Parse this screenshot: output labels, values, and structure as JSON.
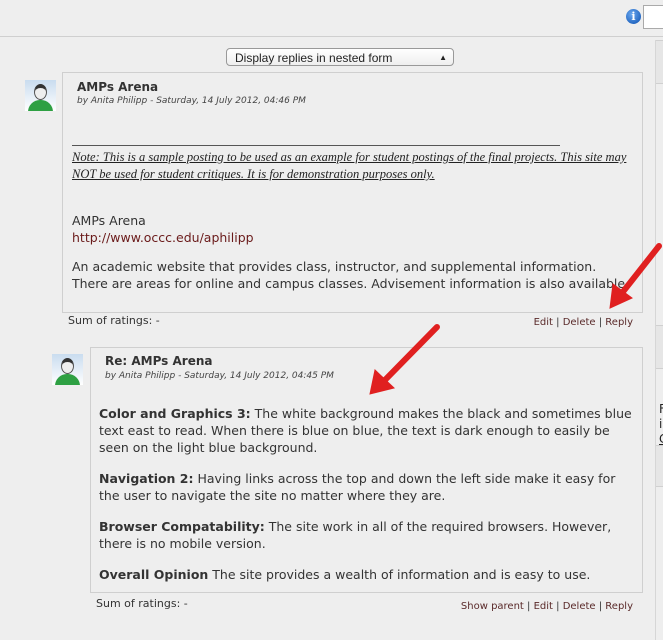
{
  "display_select": {
    "value": "Display replies in nested form"
  },
  "posts": [
    {
      "title": "AMPs Arena",
      "byline": "by Anita Philipp - Saturday, 14 July 2012, 04:46 PM",
      "note": "Note: This is a sample posting to be used as an example for student postings of the final projects. This site may NOT be used for student critiques. It is for demonstration purposes only.",
      "site_name": "AMPs Arena",
      "site_url": "http://www.occc.edu/aphilipp",
      "body": "An academic website that provides class, instructor, and supplemental information.  There are areas for online and campus classes. Advisement information is also available.",
      "ratings": "Sum of ratings: -",
      "commands": [
        "Edit",
        "Delete",
        "Reply"
      ]
    },
    {
      "title": "Re: AMPs Arena",
      "byline": "by Anita Philipp - Saturday, 14 July 2012, 04:45 PM",
      "paragraphs": [
        {
          "label": "Color and Graphics 3:",
          "text": " The white background makes the black and sometimes blue text east to read.  When there is blue on blue, the text is dark enough to easily be seen on the light blue background."
        },
        {
          "label": "Navigation 2:",
          "text": " Having links across the top and down the left side make it easy for the user to navigate the site no matter where they are."
        },
        {
          "label": "Browser Compatability:",
          "text": " The site work in all of the required browsers.  However, there is no mobile version."
        },
        {
          "label": "Overall Opinion",
          "text": " The site provides a wealth of information and is easy to use."
        }
      ],
      "ratings": "Sum of ratings: -",
      "commands": [
        "Show parent",
        "Edit",
        "Delete",
        "Reply"
      ]
    }
  ],
  "sidebar": {
    "fragments": [
      "F",
      "is",
      "C"
    ]
  },
  "colors": {
    "arrow": "#e02020",
    "background": "#eeeeee"
  }
}
